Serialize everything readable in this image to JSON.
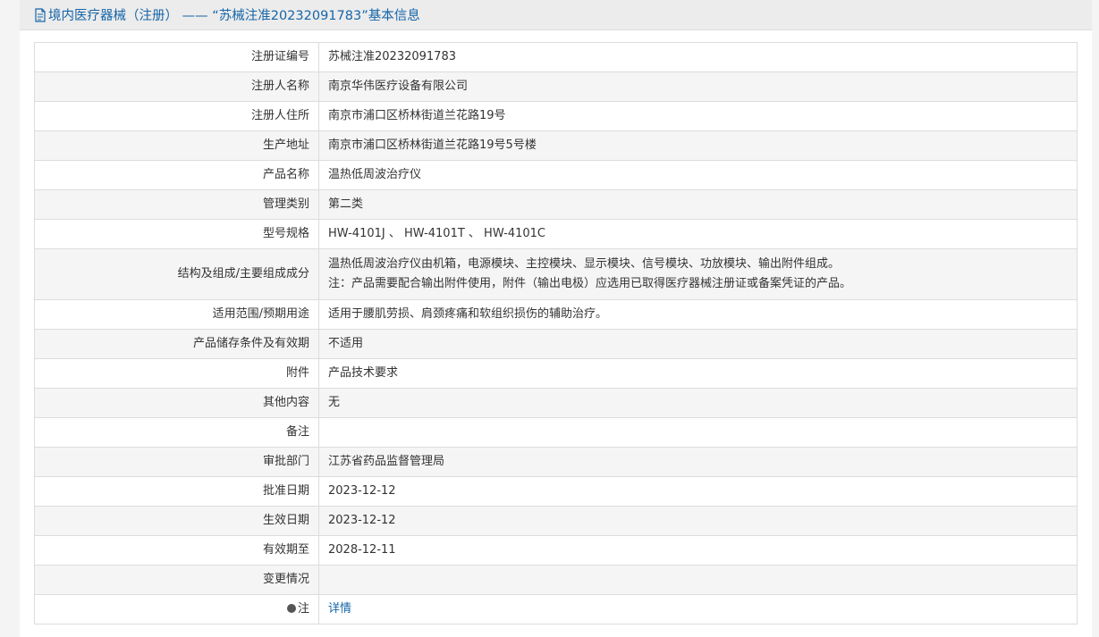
{
  "header": {
    "title": "境内医疗器械（注册） ——  “苏械注准20232091783”基本信息",
    "icon": "document-icon"
  },
  "rows": [
    {
      "label": "注册证编号",
      "value": "苏械注准20232091783"
    },
    {
      "label": "注册人名称",
      "value": "南京华伟医疗设备有限公司"
    },
    {
      "label": "注册人住所",
      "value": "南京市浦口区桥林街道兰花路19号"
    },
    {
      "label": "生产地址",
      "value": "南京市浦口区桥林街道兰花路19号5号楼"
    },
    {
      "label": "产品名称",
      "value": "温热低周波治疗仪"
    },
    {
      "label": "管理类别",
      "value": "第二类"
    },
    {
      "label": "型号规格",
      "value": "HW-4101J 、 HW-4101T 、 HW-4101C"
    },
    {
      "label": "结构及组成/主要组成成分",
      "value_line1": "温热低周波治疗仪由机箱，电源模块、主控模块、显示模块、信号模块、功放模块、输出附件组成。",
      "value_line2": "注：产品需要配合输出附件使用，附件（输出电极）应选用已取得医疗器械注册证或备案凭证的产品。"
    },
    {
      "label": "适用范围/预期用途",
      "value": "适用于腰肌劳损、肩颈疼痛和软组织损伤的辅助治疗。"
    },
    {
      "label": "产品储存条件及有效期",
      "value": "不适用"
    },
    {
      "label": "附件",
      "value": "产品技术要求"
    },
    {
      "label": "其他内容",
      "value": "无"
    },
    {
      "label": "备注",
      "value": ""
    },
    {
      "label": "审批部门",
      "value": "江苏省药品监督管理局"
    },
    {
      "label": "批准日期",
      "value": "2023-12-12"
    },
    {
      "label": "生效日期",
      "value": "2023-12-12"
    },
    {
      "label": "有效期至",
      "value": "2028-12-11"
    },
    {
      "label": "变更情况",
      "value": ""
    },
    {
      "label": "注",
      "value": "详情",
      "icon": "note-icon"
    }
  ]
}
